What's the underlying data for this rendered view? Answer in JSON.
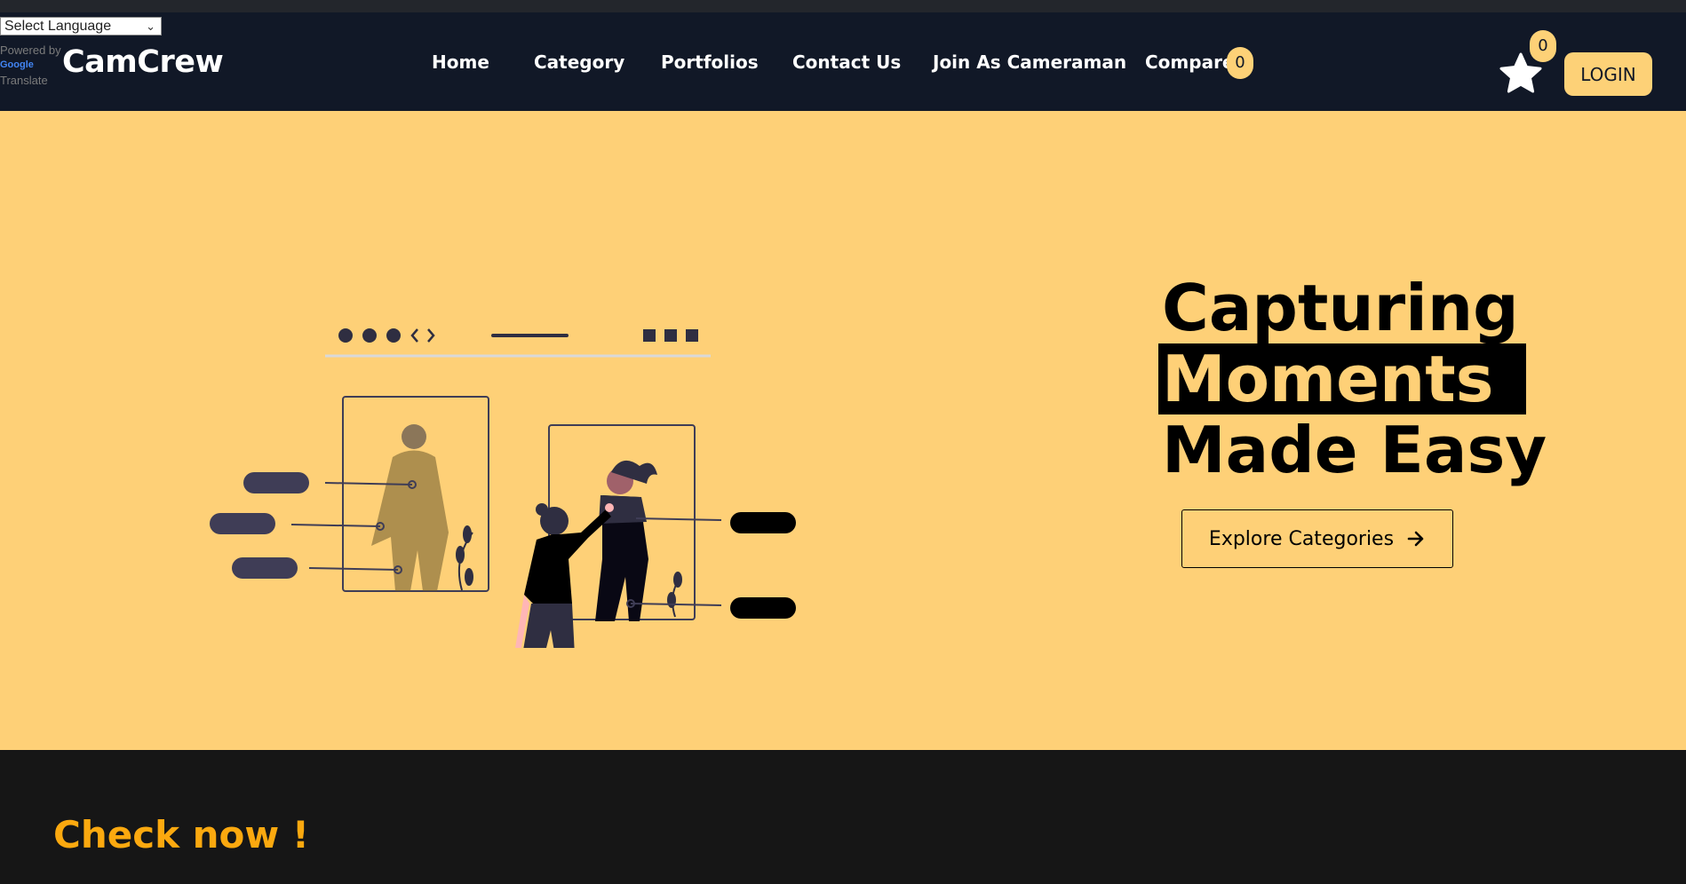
{
  "translate": {
    "select_label": "Select Language",
    "powered_by": "Powered by",
    "google": "Google",
    "translate": "Translate"
  },
  "navbar": {
    "brand": "CamCrew",
    "links": [
      "Home",
      "Category",
      "Portfolios",
      "Contact Us",
      "Join As Cameraman",
      "Compare"
    ],
    "compare_count": "0",
    "favorites_count": "0",
    "login_label": "LOGIN"
  },
  "hero": {
    "headline_line1": "Capturing",
    "headline_line2": "Moments",
    "headline_line3": "Made Easy",
    "cta_label": "Explore Categories"
  },
  "section": {
    "title": "Check now !"
  },
  "colors": {
    "navbar_bg": "#111827",
    "hero_bg": "#fed077",
    "accent": "#fdd177",
    "section_bg": "#161616",
    "section_title": "#fba90f"
  },
  "icons": [
    "chevron-down-icon",
    "star-icon",
    "arrow-right-icon"
  ]
}
